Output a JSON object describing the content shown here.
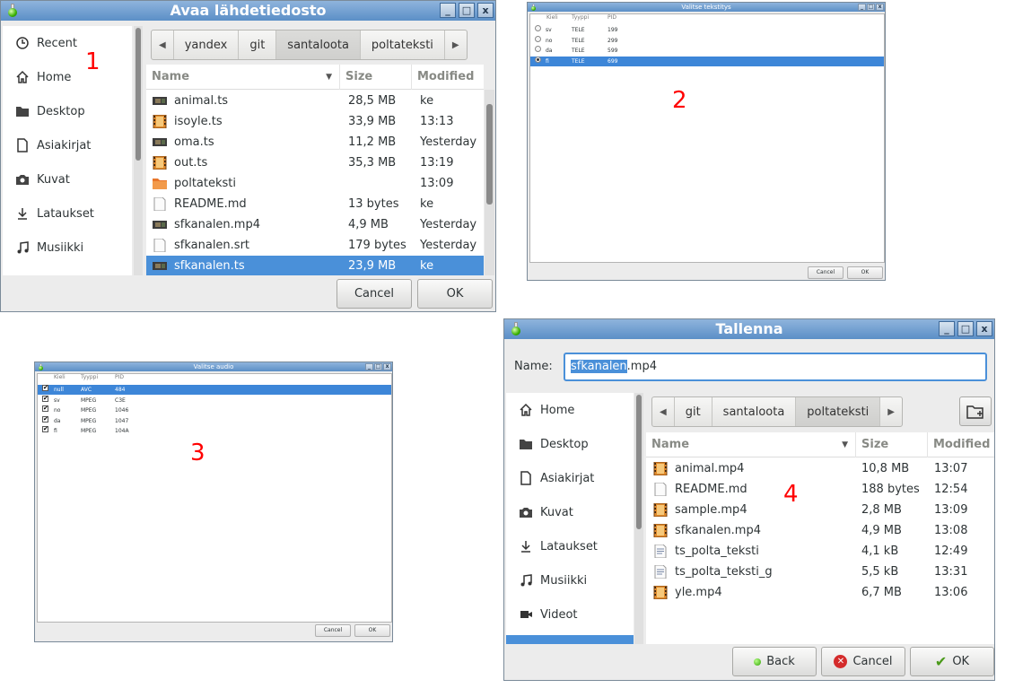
{
  "open_dialog": {
    "title": "Avaa lähdetiedosto",
    "window_buttons": [
      "_",
      "□",
      "x"
    ],
    "sidebar": [
      "Recent",
      "Home",
      "Desktop",
      "Asiakirjat",
      "Kuvat",
      "Lataukset",
      "Musiikki"
    ],
    "path": [
      "yandex",
      "git",
      "santaloota",
      "poltateksti"
    ],
    "current_crumb_index": 2,
    "columns": [
      "Name",
      "Size",
      "Modified"
    ],
    "files": [
      {
        "name": "animal.ts",
        "size": "28,5 MB",
        "modified": "ke",
        "icon": "video-thumb"
      },
      {
        "name": "isoyle.ts",
        "size": "33,9 MB",
        "modified": "13:13",
        "icon": "film"
      },
      {
        "name": "oma.ts",
        "size": "11,2 MB",
        "modified": "Yesterday",
        "icon": "video-thumb"
      },
      {
        "name": "out.ts",
        "size": "35,3 MB",
        "modified": "13:19",
        "icon": "film"
      },
      {
        "name": "poltateksti",
        "size": "",
        "modified": "13:09",
        "icon": "folder"
      },
      {
        "name": "README.md",
        "size": "13 bytes",
        "modified": "ke",
        "icon": "text"
      },
      {
        "name": "sfkanalen.mp4",
        "size": "4,9 MB",
        "modified": "Yesterday",
        "icon": "video-thumb"
      },
      {
        "name": "sfkanalen.srt",
        "size": "179 bytes",
        "modified": "Yesterday",
        "icon": "text"
      },
      {
        "name": "sfkanalen.ts",
        "size": "23,9 MB",
        "modified": "ke",
        "icon": "video-thumb"
      }
    ],
    "selected_index": 8,
    "cancel_label": "Cancel",
    "ok_label": "OK",
    "annotation": "1"
  },
  "subtitle_dialog": {
    "title": "Valitse tekstitys",
    "columns": [
      "Kieli",
      "Tyyppi",
      "PID"
    ],
    "rows": [
      {
        "lang": "sv",
        "type": "TELE",
        "pid": "199"
      },
      {
        "lang": "no",
        "type": "TELE",
        "pid": "299"
      },
      {
        "lang": "da",
        "type": "TELE",
        "pid": "599"
      },
      {
        "lang": "fi",
        "type": "TELE",
        "pid": "699"
      }
    ],
    "selected_index": 3,
    "cancel_label": "Cancel",
    "ok_label": "OK",
    "annotation": "2"
  },
  "audio_dialog": {
    "title": "Valitse audio",
    "columns": [
      "Kieli",
      "Tyyppi",
      "PID"
    ],
    "rows": [
      {
        "lang": "null",
        "type": "AVC",
        "pid": "484"
      },
      {
        "lang": "sv",
        "type": "MPEG",
        "pid": "C3E"
      },
      {
        "lang": "no",
        "type": "MPEG",
        "pid": "1046"
      },
      {
        "lang": "da",
        "type": "MPEG",
        "pid": "1047"
      },
      {
        "lang": "fi",
        "type": "MPEG",
        "pid": "104A"
      }
    ],
    "selected_index": 0,
    "cancel_label": "Cancel",
    "ok_label": "OK",
    "annotation": "3"
  },
  "save_dialog": {
    "title": "Tallenna",
    "name_label": "Name:",
    "name_highlight": "sfkanalen",
    "name_rest": ".mp4",
    "sidebar": [
      "Home",
      "Desktop",
      "Asiakirjat",
      "Kuvat",
      "Lataukset",
      "Musiikki",
      "Videot"
    ],
    "path": [
      "git",
      "santaloota",
      "poltateksti"
    ],
    "current_crumb_index": 2,
    "columns": [
      "Name",
      "Size",
      "Modified"
    ],
    "files": [
      {
        "name": "animal.mp4",
        "size": "10,8 MB",
        "modified": "13:07",
        "icon": "film"
      },
      {
        "name": "README.md",
        "size": "188 bytes",
        "modified": "12:54",
        "icon": "text"
      },
      {
        "name": "sample.mp4",
        "size": "2,8 MB",
        "modified": "13:09",
        "icon": "film"
      },
      {
        "name": "sfkanalen.mp4",
        "size": "4,9 MB",
        "modified": "13:08",
        "icon": "film"
      },
      {
        "name": "ts_polta_teksti",
        "size": "4,1 kB",
        "modified": "12:49",
        "icon": "script"
      },
      {
        "name": "ts_polta_teksti_g",
        "size": "5,5 kB",
        "modified": "13:31",
        "icon": "script"
      },
      {
        "name": "yle.mp4",
        "size": "6,7 MB",
        "modified": "13:06",
        "icon": "film"
      }
    ],
    "back_label": "Back",
    "cancel_label": "Cancel",
    "ok_label": "OK",
    "annotation": "4"
  },
  "colors": {
    "selection": "#4a90d9",
    "annotation": "#ff0000",
    "titlebar": "#6f9dd0"
  }
}
